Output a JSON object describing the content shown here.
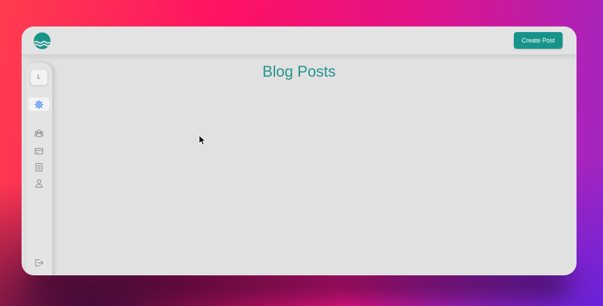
{
  "header": {
    "logo_icon": "waves-logo-icon",
    "create_button_label": "Create Post"
  },
  "sidebar": {
    "avatar_initial": "L",
    "items": [
      {
        "icon": "settings-icon",
        "active": true
      },
      {
        "icon": "users-icon",
        "active": false
      },
      {
        "icon": "credit-card-icon",
        "active": false
      },
      {
        "icon": "document-icon",
        "active": false
      },
      {
        "icon": "user-icon",
        "active": false
      }
    ],
    "footer_icon": "logout-icon"
  },
  "main": {
    "title": "Blog Posts"
  },
  "colors": {
    "accent": "#16948a",
    "title": "#24958b",
    "active_icon": "#3b82f6",
    "icon": "#8a8a8a"
  }
}
